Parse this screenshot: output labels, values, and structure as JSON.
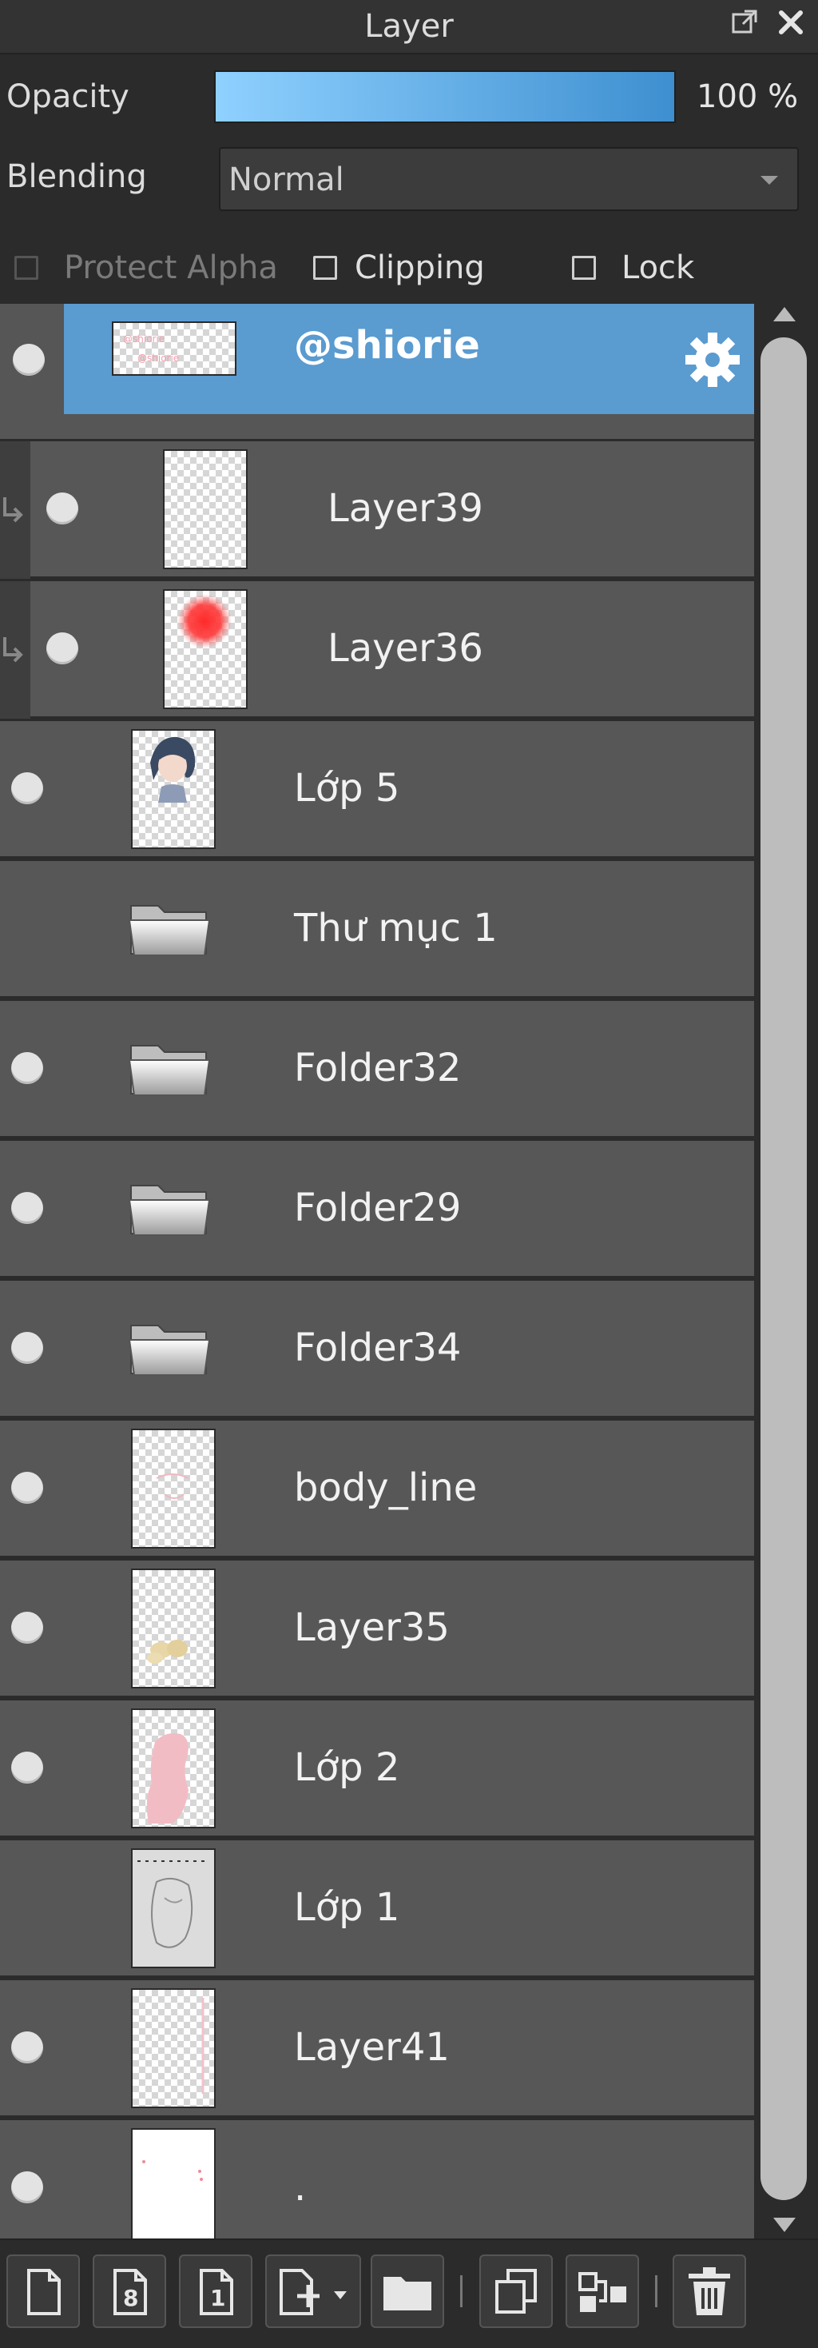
{
  "panel": {
    "title": "Layer",
    "popout_icon": "popout-icon",
    "close_icon": "close-icon"
  },
  "properties": {
    "opacity_label": "Opacity",
    "opacity_value": "100 %",
    "opacity_percent": 100,
    "blending_label": "Blending",
    "blending_value": "Normal",
    "protect_alpha_label": "Protect Alpha",
    "protect_alpha_checked": false,
    "protect_alpha_enabled": false,
    "clipping_label": "Clipping",
    "clipping_checked": false,
    "lock_label": "Lock",
    "lock_checked": false
  },
  "layers": [
    {
      "name": "@shiorie",
      "selected": true,
      "visible": true,
      "kind": "layer",
      "clipped": false
    },
    {
      "name": "Layer39",
      "selected": false,
      "visible": true,
      "kind": "layer",
      "clipped": true
    },
    {
      "name": "Layer36",
      "selected": false,
      "visible": true,
      "kind": "layer",
      "clipped": true
    },
    {
      "name": "Lớp 5",
      "selected": false,
      "visible": true,
      "kind": "layer",
      "clipped": false
    },
    {
      "name": "Thư mục 1",
      "selected": false,
      "visible": false,
      "kind": "folder",
      "clipped": false
    },
    {
      "name": "Folder32",
      "selected": false,
      "visible": true,
      "kind": "folder",
      "clipped": false
    },
    {
      "name": "Folder29",
      "selected": false,
      "visible": true,
      "kind": "folder",
      "clipped": false
    },
    {
      "name": "Folder34",
      "selected": false,
      "visible": true,
      "kind": "folder",
      "clipped": false
    },
    {
      "name": "body_line",
      "selected": false,
      "visible": true,
      "kind": "layer",
      "clipped": false
    },
    {
      "name": "Layer35",
      "selected": false,
      "visible": true,
      "kind": "layer",
      "clipped": false
    },
    {
      "name": "Lớp 2",
      "selected": false,
      "visible": true,
      "kind": "layer",
      "clipped": false
    },
    {
      "name": "Lớp 1",
      "selected": false,
      "visible": false,
      "kind": "layer",
      "clipped": false
    },
    {
      "name": "Layer41",
      "selected": false,
      "visible": true,
      "kind": "layer",
      "clipped": false
    },
    {
      "name": ".",
      "selected": false,
      "visible": true,
      "kind": "layer",
      "clipped": false
    }
  ],
  "toolbar": {
    "buttons": [
      "new-layer-icon",
      "new-8bit-layer-icon",
      "new-1bit-layer-icon",
      "add-layer-dropdown-icon",
      "new-folder-icon",
      "duplicate-layer-icon",
      "merge-down-icon",
      "delete-layer-icon"
    ]
  },
  "colors": {
    "selected_row": "#5a9bd0",
    "row": "#575757",
    "background": "#2b2b2b",
    "opacity_start": "#8fd1ff",
    "opacity_end": "#3e8fd0"
  }
}
